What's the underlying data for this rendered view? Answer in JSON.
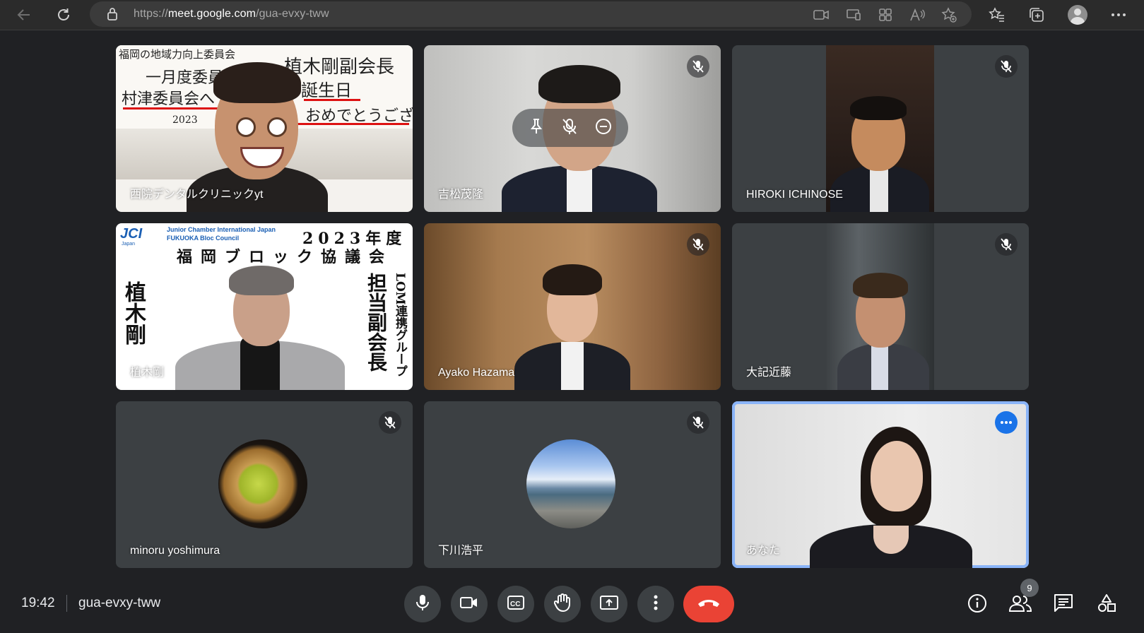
{
  "browser": {
    "url_scheme": "https://",
    "url_host": "meet.google.com",
    "url_path": "/gua-evxy-tww"
  },
  "tiles": [
    {
      "name": "西院デンタルクリニックyt",
      "muted": false,
      "banner": {
        "line1": "福岡の地域力向上委員会",
        "line2": "一月度委員",
        "line3": "村津委員会へ",
        "line4": "植木剛副会長",
        "line5": "誕生日",
        "line6": "おめでとうございます",
        "line7": "2023"
      }
    },
    {
      "name": "吉松茂隆",
      "muted": true
    },
    {
      "name": "HIROKI ICHINOSE",
      "muted": true
    },
    {
      "name": "植木剛",
      "muted": false,
      "banner": {
        "org_logo": "JCI",
        "org_logo_sub": "Japan",
        "org_en1": "Junior Chamber International Japan",
        "org_en2": "FUKUOKA Bloc Council",
        "year": "2023年度",
        "council": "福岡ブロック協議会",
        "person_name": "植木剛",
        "title": "担当副会長",
        "group": "LOM連携グループ"
      }
    },
    {
      "name": "Ayako Hazama",
      "muted": true
    },
    {
      "name": "大記近藤",
      "muted": true
    },
    {
      "name": "minoru yoshimura",
      "muted": true
    },
    {
      "name": "下川浩平",
      "muted": true
    },
    {
      "name": "あなた",
      "muted": false,
      "self": true
    }
  ],
  "bottom_bar": {
    "time": "19:42",
    "meeting_code": "gua-evxy-tww",
    "participants_count": "9"
  },
  "colors": {
    "background": "#202124",
    "tile": "#3c4043",
    "leave_red": "#ea4335",
    "self_border": "#8ab4f8",
    "more_blue": "#1a73e8"
  },
  "icons": [
    "back-icon",
    "reload-icon",
    "lock-icon",
    "camera-icon",
    "cast-icon",
    "apps-icon",
    "read-aloud-icon",
    "add-favorite-icon",
    "favorites-icon",
    "collections-icon",
    "profile-icon",
    "more-icon",
    "mic-icon",
    "camera-icon",
    "captions-icon",
    "hand-icon",
    "present-icon",
    "more-vert-icon",
    "leave-call-icon",
    "info-icon",
    "people-icon",
    "chat-icon",
    "activities-icon",
    "mic-off-icon",
    "pin-icon",
    "remove-icon"
  ]
}
